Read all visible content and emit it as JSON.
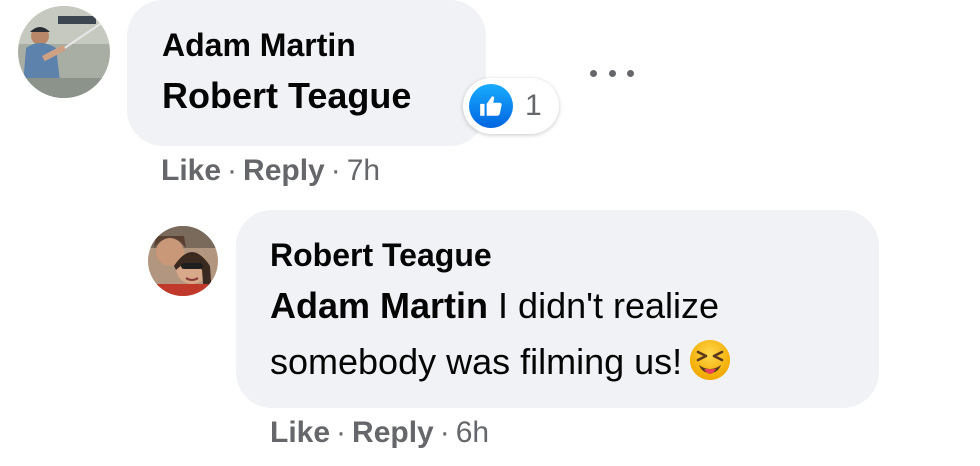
{
  "comments": [
    {
      "author": "Adam Martin",
      "text": "Robert Teague",
      "avatar": "fishing-man-avatar",
      "reaction": {
        "icon": "like-icon",
        "count": "1",
        "color": "#1877f2"
      },
      "actions": {
        "like": "Like",
        "reply": "Reply",
        "time": "7h",
        "separator": "·"
      }
    },
    {
      "author": "Robert Teague",
      "mention": "Adam Martin",
      "text": "I didn't realize somebody was filming us!",
      "emoji": "squinting-face-with-tongue-icon",
      "avatar": "couple-selfie-avatar",
      "actions": {
        "like": "Like",
        "reply": "Reply",
        "time": "6h",
        "separator": "·"
      }
    }
  ],
  "more_options_icon": "more-horizontal-icon",
  "colors": {
    "bubble": "#f0f2f5",
    "secondary_text": "#65676b",
    "primary_text": "#050505",
    "like_blue": "#1877f2"
  }
}
